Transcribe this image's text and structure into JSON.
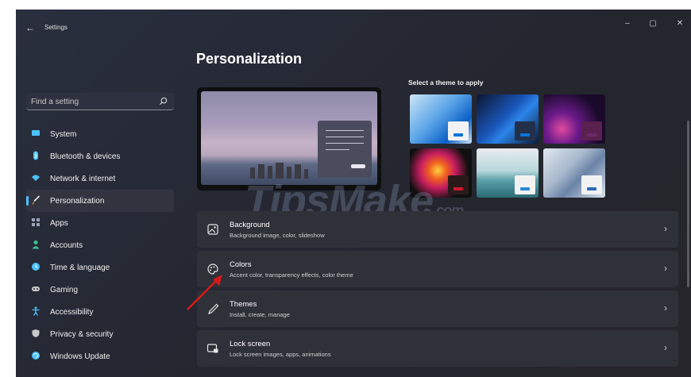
{
  "window": {
    "back_glyph": "←",
    "title": "Settings",
    "controls": {
      "minimize": "–",
      "maximize": "▢",
      "close": "✕"
    }
  },
  "search": {
    "placeholder": "Find a setting"
  },
  "nav": {
    "items": [
      {
        "label": "System",
        "icon": "system-icon",
        "color": "#4cc2ff"
      },
      {
        "label": "Bluetooth & devices",
        "icon": "bluetooth-icon",
        "color": "#4cc2ff"
      },
      {
        "label": "Network & internet",
        "icon": "wifi-icon",
        "color": "#4cc2ff"
      },
      {
        "label": "Personalization",
        "icon": "brush-icon",
        "color": "#f0a030",
        "selected": true
      },
      {
        "label": "Apps",
        "icon": "apps-icon",
        "color": "#9aa3b8"
      },
      {
        "label": "Accounts",
        "icon": "person-icon",
        "color": "#3ec28f"
      },
      {
        "label": "Time & language",
        "icon": "globe-icon",
        "color": "#4cc2ff"
      },
      {
        "label": "Gaming",
        "icon": "gamepad-icon",
        "color": "#c8c8c8"
      },
      {
        "label": "Accessibility",
        "icon": "accessibility-icon",
        "color": "#4cc2ff"
      },
      {
        "label": "Privacy & security",
        "icon": "shield-icon",
        "color": "#c8c8c8"
      },
      {
        "label": "Windows Update",
        "icon": "update-icon",
        "color": "#4cc2ff"
      }
    ]
  },
  "main": {
    "title": "Personalization",
    "theme_label": "Select a theme to apply",
    "themes": [
      {
        "name": "theme-windows-light",
        "accent": "#0a74d8"
      },
      {
        "name": "theme-windows-dark",
        "accent": "#0a74d8"
      },
      {
        "name": "theme-glow",
        "accent": "#6a2a6a"
      },
      {
        "name": "theme-captured-motion",
        "accent": "#d01830"
      },
      {
        "name": "theme-sunrise",
        "accent": "#2a8ad8"
      },
      {
        "name": "theme-flow",
        "accent": "#2a6ab8"
      }
    ],
    "cards": [
      {
        "title": "Background",
        "subtitle": "Background image, color, slideshow",
        "icon": "image-icon"
      },
      {
        "title": "Colors",
        "subtitle": "Accent color, transparency effects, color theme",
        "icon": "palette-icon"
      },
      {
        "title": "Themes",
        "subtitle": "Install, create, manage",
        "icon": "pen-icon"
      },
      {
        "title": "Lock screen",
        "subtitle": "Lock screen images, apps, animations",
        "icon": "lock-screen-icon"
      }
    ],
    "chevron": "›"
  },
  "watermark": {
    "text": "TipsMake",
    "suffix": ".com"
  }
}
